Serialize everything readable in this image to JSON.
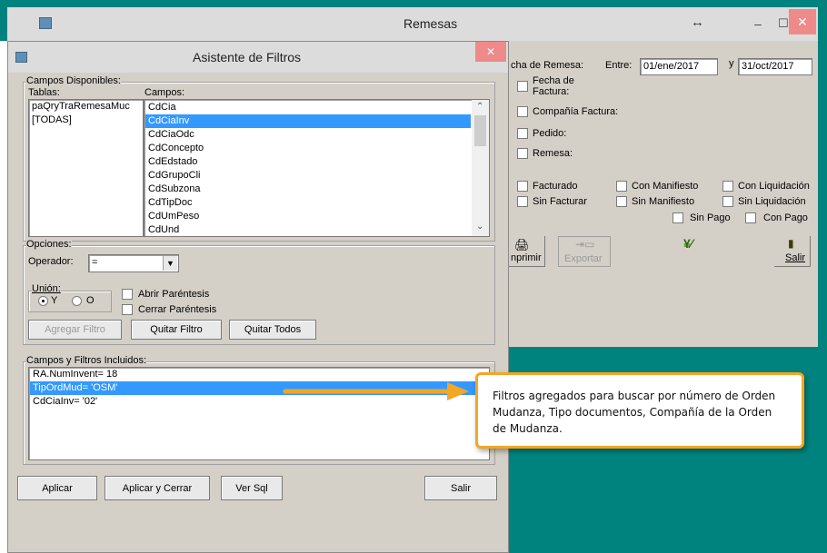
{
  "main_window": {
    "title": "Remesas",
    "resize_glyph": "↔",
    "minimize": "–",
    "maximize": "☐",
    "close": "✕",
    "fecha_remesa_label": "cha de Remesa:",
    "entre_label": "Entre:",
    "fecha_desde": "01/ene/2017",
    "y_label": "y",
    "fecha_hasta": "31/oct/2017",
    "filters": [
      "Fecha de Factura:",
      "Compañía Factura:",
      "Pedido:",
      "Remesa:"
    ],
    "status_checks": {
      "facturado": "Facturado",
      "sin_facturar": "Sin Facturar",
      "con_manifiesto": "Con Manifiesto",
      "sin_manifiesto": "Sin Manifiesto",
      "con_liquidacion": "Con Liquidación",
      "sin_liquidacion": "Sin Liquidación",
      "sin_pago": "Sin Pago",
      "con_pago": "Con Pago"
    },
    "toolbar": {
      "imprimir": "nprimir",
      "exportar": "Exportar",
      "salir": "Salir"
    }
  },
  "dialog": {
    "title": "Asistente de Filtros",
    "close": "✕",
    "campos_disponibles": "Campos Disponibles:",
    "tablas_label": "Tablas:",
    "campos_label": "Campos:",
    "tablas": [
      "paQryTraRemesaMuc",
      "[TODAS]"
    ],
    "campos": [
      "CdCia",
      "CdCiaInv",
      "CdCiaOdc",
      "CdConcepto",
      "CdEdstado",
      "CdGrupoCli",
      "CdSubzona",
      "CdTipDoc",
      "CdUmPeso",
      "CdUnd"
    ],
    "campos_selected_index": 1,
    "opciones": "Opciones:",
    "operador_label": "Operador:",
    "operador_value": "=",
    "union_label": "Unión:",
    "union_y": "Y",
    "union_o": "O",
    "abrir_parentesis": "Abrir Paréntesis",
    "cerrar_parentesis": "Cerrar Paréntesis",
    "agregar_filtro": "Agregar Filtro",
    "quitar_filtro": "Quitar Filtro",
    "quitar_todos": "Quitar Todos",
    "incluidos_label": "Campos y Filtros Incluidos:",
    "incluidos": [
      "RA.NumInvent= 18",
      "TipOrdMud= 'OSM'",
      "CdCiaInv= '02'"
    ],
    "incluidos_selected_index": 1,
    "aplicar": "Aplicar",
    "aplicar_cerrar": "Aplicar y Cerrar",
    "ver_sql": "Ver Sql",
    "salir": "Salir"
  },
  "callout": {
    "text": "Filtros agregados para buscar por número de Orden Mudanza, Tipo documentos, Compañía de la Orden de Mudanza.",
    "border_color": "#f5a623",
    "arrow_color": "#f5a623"
  },
  "colors": {
    "teal": "#00837f",
    "selection": "#3399ff"
  }
}
